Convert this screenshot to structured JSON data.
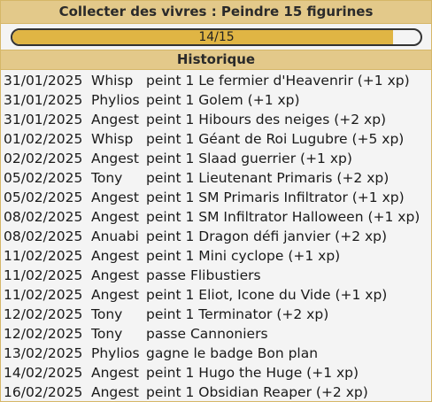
{
  "quest": {
    "title": "Collecter des vivres : Peindre 15 figurines",
    "progress_text": "14/15",
    "progress_fraction": 0.9333,
    "progress_color": "#e0b544"
  },
  "history": {
    "title": "Historique",
    "rows": [
      {
        "date": "31/01/2025",
        "user": "Whisp",
        "action": "peint 1 Le fermier d'Heavenrir (+1 xp)"
      },
      {
        "date": "31/01/2025",
        "user": "Phylios",
        "action": "peint 1 Golem (+1 xp)"
      },
      {
        "date": "31/01/2025",
        "user": "Angest",
        "action": "peint 1 Hibours des neiges (+2 xp)"
      },
      {
        "date": "01/02/2025",
        "user": "Whisp",
        "action": "peint 1 Géant de Roi Lugubre (+5 xp)"
      },
      {
        "date": "02/02/2025",
        "user": "Angest",
        "action": "peint 1 Slaad guerrier (+1 xp)"
      },
      {
        "date": "05/02/2025",
        "user": "Tony",
        "action": "peint 1 Lieutenant Primaris (+2 xp)"
      },
      {
        "date": "05/02/2025",
        "user": "Angest",
        "action": "peint 1 SM Primaris Infiltrator (+1 xp)"
      },
      {
        "date": "08/02/2025",
        "user": "Angest",
        "action": "peint 1 SM Infiltrator Halloween (+1 xp)"
      },
      {
        "date": "08/02/2025",
        "user": "Anuabi",
        "action": "peint 1 Dragon défi janvier (+2 xp)"
      },
      {
        "date": "11/02/2025",
        "user": "Angest",
        "action": "peint 1 Mini cyclope (+1 xp)"
      },
      {
        "date": "11/02/2025",
        "user": "Angest",
        "action": "passe Flibustiers"
      },
      {
        "date": "11/02/2025",
        "user": "Angest",
        "action": "peint 1 Eliot, Icone du Vide (+1 xp)"
      },
      {
        "date": "12/02/2025",
        "user": "Tony",
        "action": "peint 1 Terminator (+2 xp)"
      },
      {
        "date": "12/02/2025",
        "user": "Tony",
        "action": "passe Cannoniers"
      },
      {
        "date": "13/02/2025",
        "user": "Phylios",
        "action": "gagne le badge Bon plan"
      },
      {
        "date": "14/02/2025",
        "user": "Angest",
        "action": "peint 1 Hugo the Huge (+1 xp)"
      },
      {
        "date": "16/02/2025",
        "user": "Angest",
        "action": "peint 1 Obsidian Reaper (+2 xp)"
      }
    ]
  }
}
